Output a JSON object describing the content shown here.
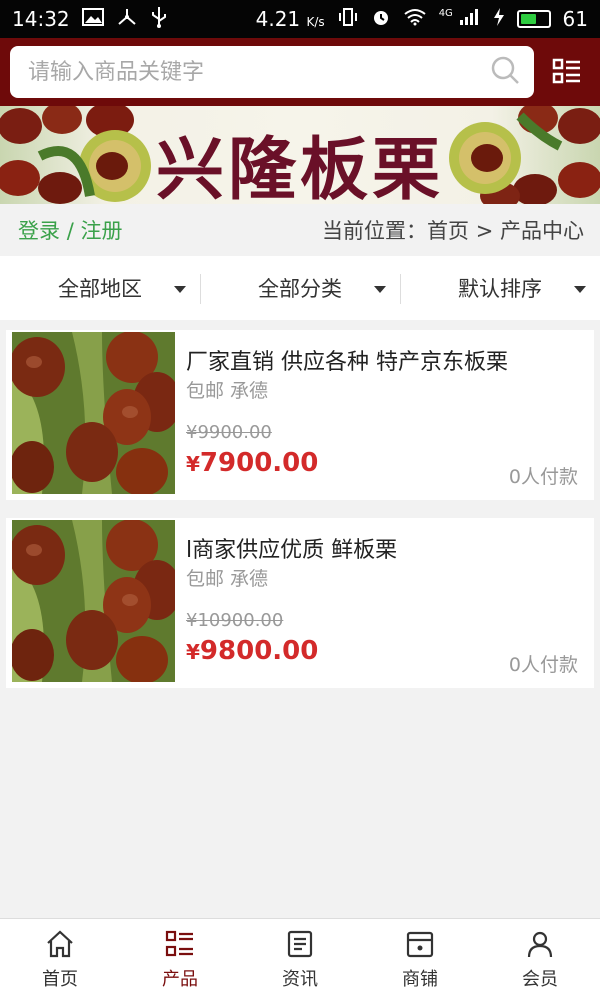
{
  "status_bar": {
    "time": "14:32",
    "speed": "4.21",
    "speed_unit": "K/s",
    "network": "4G",
    "battery": "61",
    "battery_level": 0.61
  },
  "header": {
    "search_placeholder": "请输入商品关键字"
  },
  "banner": {
    "title": "兴隆板栗"
  },
  "account": {
    "login": "登录",
    "separator": "/",
    "register": "注册"
  },
  "breadcrumb": {
    "text": "当前位置：首页 > 产品中心"
  },
  "filters": [
    {
      "label": "全部地区"
    },
    {
      "label": "全部分类"
    },
    {
      "label": "默认排序"
    }
  ],
  "products": [
    {
      "title": "厂家直销 供应各种 特产京东板栗",
      "meta": "包邮 承德",
      "old_price": "¥9900.00",
      "price_symbol": "¥",
      "price": "7900.00",
      "paid": "0人付款"
    },
    {
      "title": "l商家供应优质 鲜板栗",
      "meta": "包邮 承德",
      "old_price": "¥10900.00",
      "price_symbol": "¥",
      "price": "9800.00",
      "paid": "0人付款"
    }
  ],
  "nav": [
    {
      "label": "首页",
      "icon": "home-icon"
    },
    {
      "label": "产品",
      "icon": "list-icon",
      "active": true
    },
    {
      "label": "资讯",
      "icon": "news-icon"
    },
    {
      "label": "商铺",
      "icon": "store-icon"
    },
    {
      "label": "会员",
      "icon": "user-icon"
    }
  ],
  "colors": {
    "header_bg": "#6e0a0a",
    "price_red": "#d32a2a",
    "link_green": "#3aa14a",
    "nav_active": "#7a0e0e"
  }
}
